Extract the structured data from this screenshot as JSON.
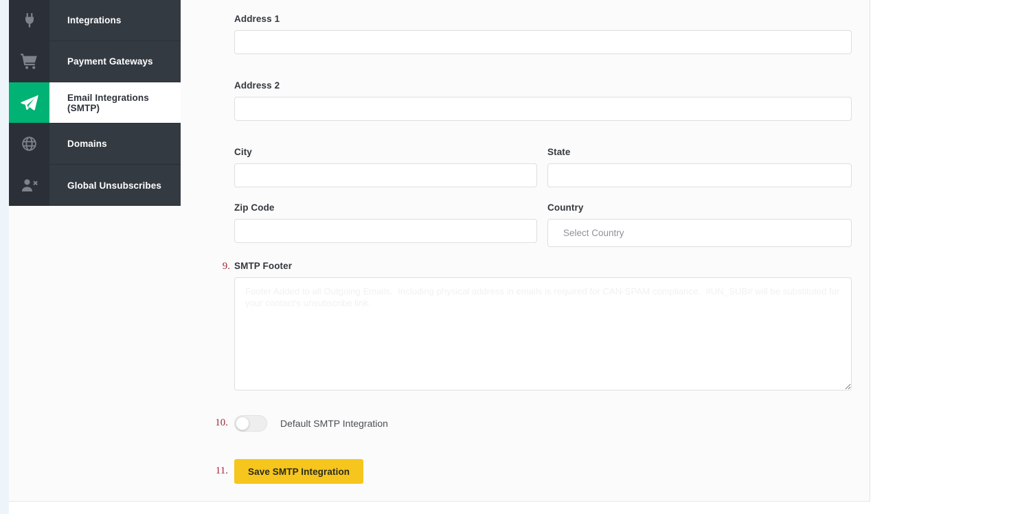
{
  "sidebar": {
    "items": [
      {
        "label": "Integrations",
        "icon": "plug-icon",
        "active": false
      },
      {
        "label": "Payment Gateways",
        "icon": "shopping-cart-icon",
        "active": false
      },
      {
        "label": "Email Integrations (SMTP)",
        "icon": "paper-plane-icon",
        "active": true
      },
      {
        "label": "Domains",
        "icon": "globe-icon",
        "active": false
      },
      {
        "label": "Global Unsubscribes",
        "icon": "user-remove-icon",
        "active": false
      }
    ]
  },
  "form": {
    "address1": {
      "label": "Address 1",
      "value": "",
      "placeholder": ""
    },
    "address2": {
      "label": "Address 2",
      "value": "",
      "placeholder": ""
    },
    "city": {
      "label": "City",
      "value": "",
      "placeholder": ""
    },
    "state": {
      "label": "State",
      "value": "",
      "placeholder": ""
    },
    "zip": {
      "label": "Zip Code",
      "value": "",
      "placeholder": ""
    },
    "country": {
      "label": "Country",
      "value": "",
      "placeholder": "Select Country"
    },
    "smtp_footer": {
      "label": "SMTP Footer",
      "step": "9.",
      "value": "",
      "placeholder": "Footer Added to all Outgoing Emails.  Including physical address in emails is required for CAN-SPAM compliance.  #UN_SUB# will be substituted for your contact's unsubscribe link."
    },
    "default_toggle": {
      "step": "10.",
      "label": "Default SMTP Integration",
      "state": "off"
    },
    "save": {
      "step": "11.",
      "label": "Save SMTP Integration"
    }
  },
  "colors": {
    "accent_green": "#00b274",
    "sidebar_dark": "#343a42",
    "sidebar_icon_dark": "#2b3038",
    "save_yellow": "#f6c61e",
    "step_number_red": "#a32638"
  }
}
